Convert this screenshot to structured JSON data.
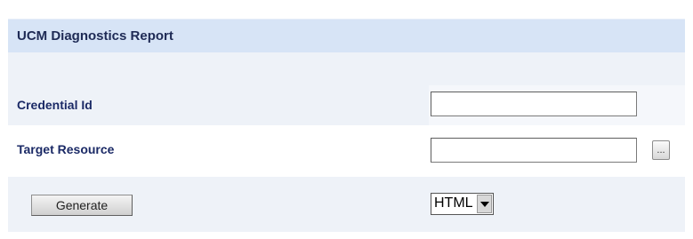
{
  "report": {
    "title": "UCM Diagnostics Report"
  },
  "form": {
    "credential_id": {
      "label": "Credential Id",
      "value": ""
    },
    "target_resource": {
      "label": "Target Resource",
      "value": "",
      "browse_label": "..."
    },
    "generate_label": "Generate",
    "format": {
      "selected": "HTML"
    }
  },
  "icons": {
    "dropdown": "chevron-down-icon"
  }
}
